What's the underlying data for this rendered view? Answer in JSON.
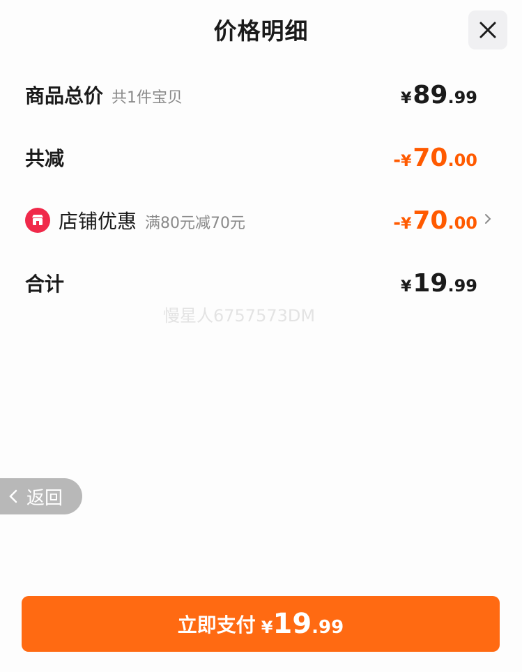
{
  "header": {
    "title": "价格明细",
    "close_icon": "close-icon"
  },
  "rows": {
    "total": {
      "label": "商品总价",
      "sub": "共1件宝贝",
      "currency": "¥",
      "int": "89",
      "dec": ".99"
    },
    "discount": {
      "label": "共减",
      "sign": "-",
      "currency": "¥",
      "int": "70",
      "dec": ".00"
    },
    "shop_coupon": {
      "icon": "shop-icon",
      "label": "店铺优惠",
      "sub": "满80元减70元",
      "sign": "-",
      "currency": "¥",
      "int": "70",
      "dec": ".00"
    },
    "sum": {
      "label": "合计",
      "currency": "¥",
      "int": "19",
      "dec": ".99"
    }
  },
  "watermark": "慢星人6757573DM",
  "back_button": {
    "label": "返回"
  },
  "pay_button": {
    "label": "立即支付",
    "currency": "¥",
    "int": "19",
    "dec": ".99"
  },
  "colors": {
    "accent": "#ff6a12",
    "discount": "#ff5a00",
    "shop_icon": "#f0294a"
  }
}
